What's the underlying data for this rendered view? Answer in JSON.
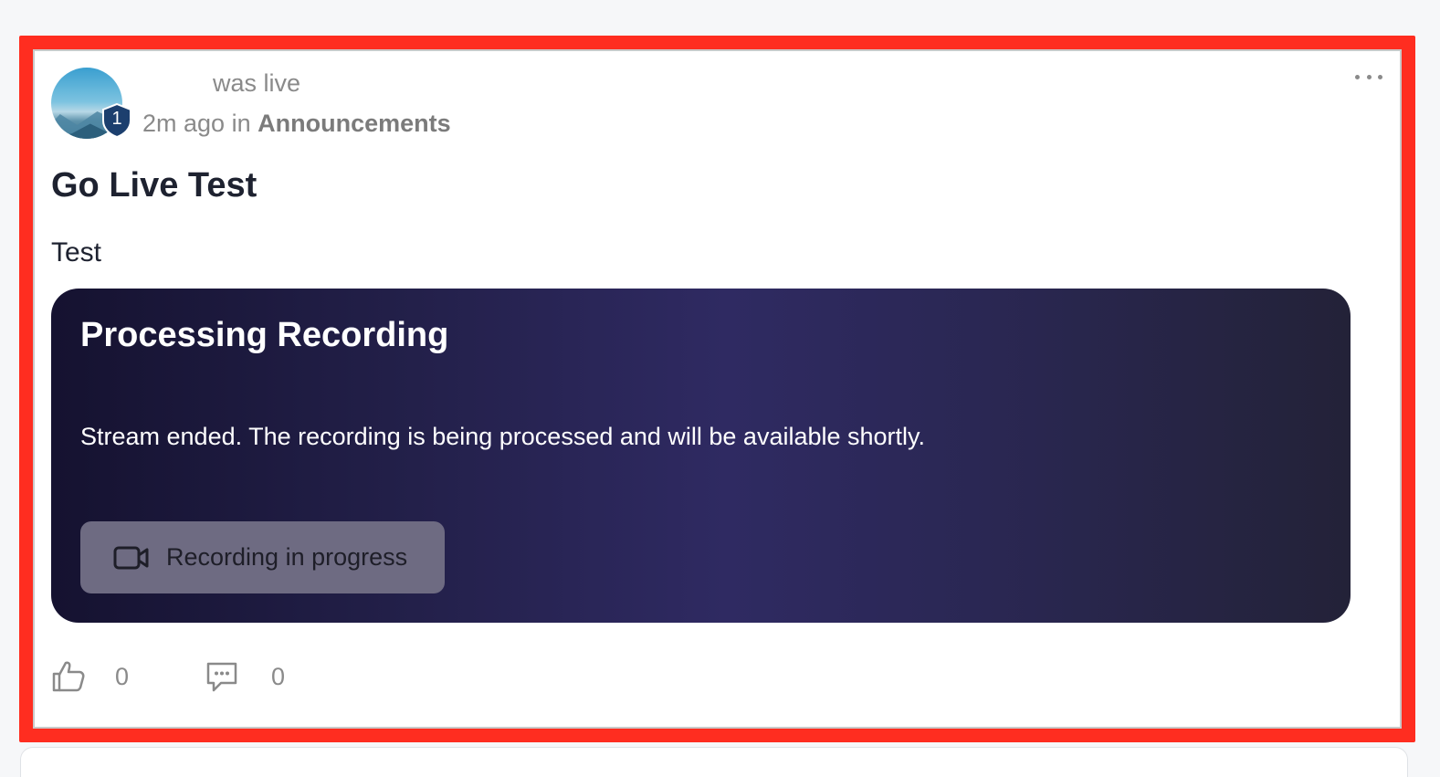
{
  "post": {
    "author_action": "was live",
    "time": "2m ago",
    "in_label": "in",
    "community": "Announcements",
    "avatar_badge": "1",
    "title": "Go Live Test",
    "body": "Test",
    "more_icon": "more-horizontal-icon"
  },
  "recording": {
    "title": "Processing Recording",
    "message": "Stream ended. The recording is being processed and will be available shortly.",
    "button_label": "Recording in progress",
    "button_icon": "video-camera-icon"
  },
  "actions": {
    "like_icon": "thumbs-up-icon",
    "like_count": "0",
    "comment_icon": "comment-icon",
    "comment_count": "0"
  },
  "colors": {
    "highlight": "#ff2d20",
    "panel_dark": "#151230",
    "panel_mid": "#2f2a62",
    "button_bg": "#6e6b82",
    "badge": "#1c3f6e"
  }
}
